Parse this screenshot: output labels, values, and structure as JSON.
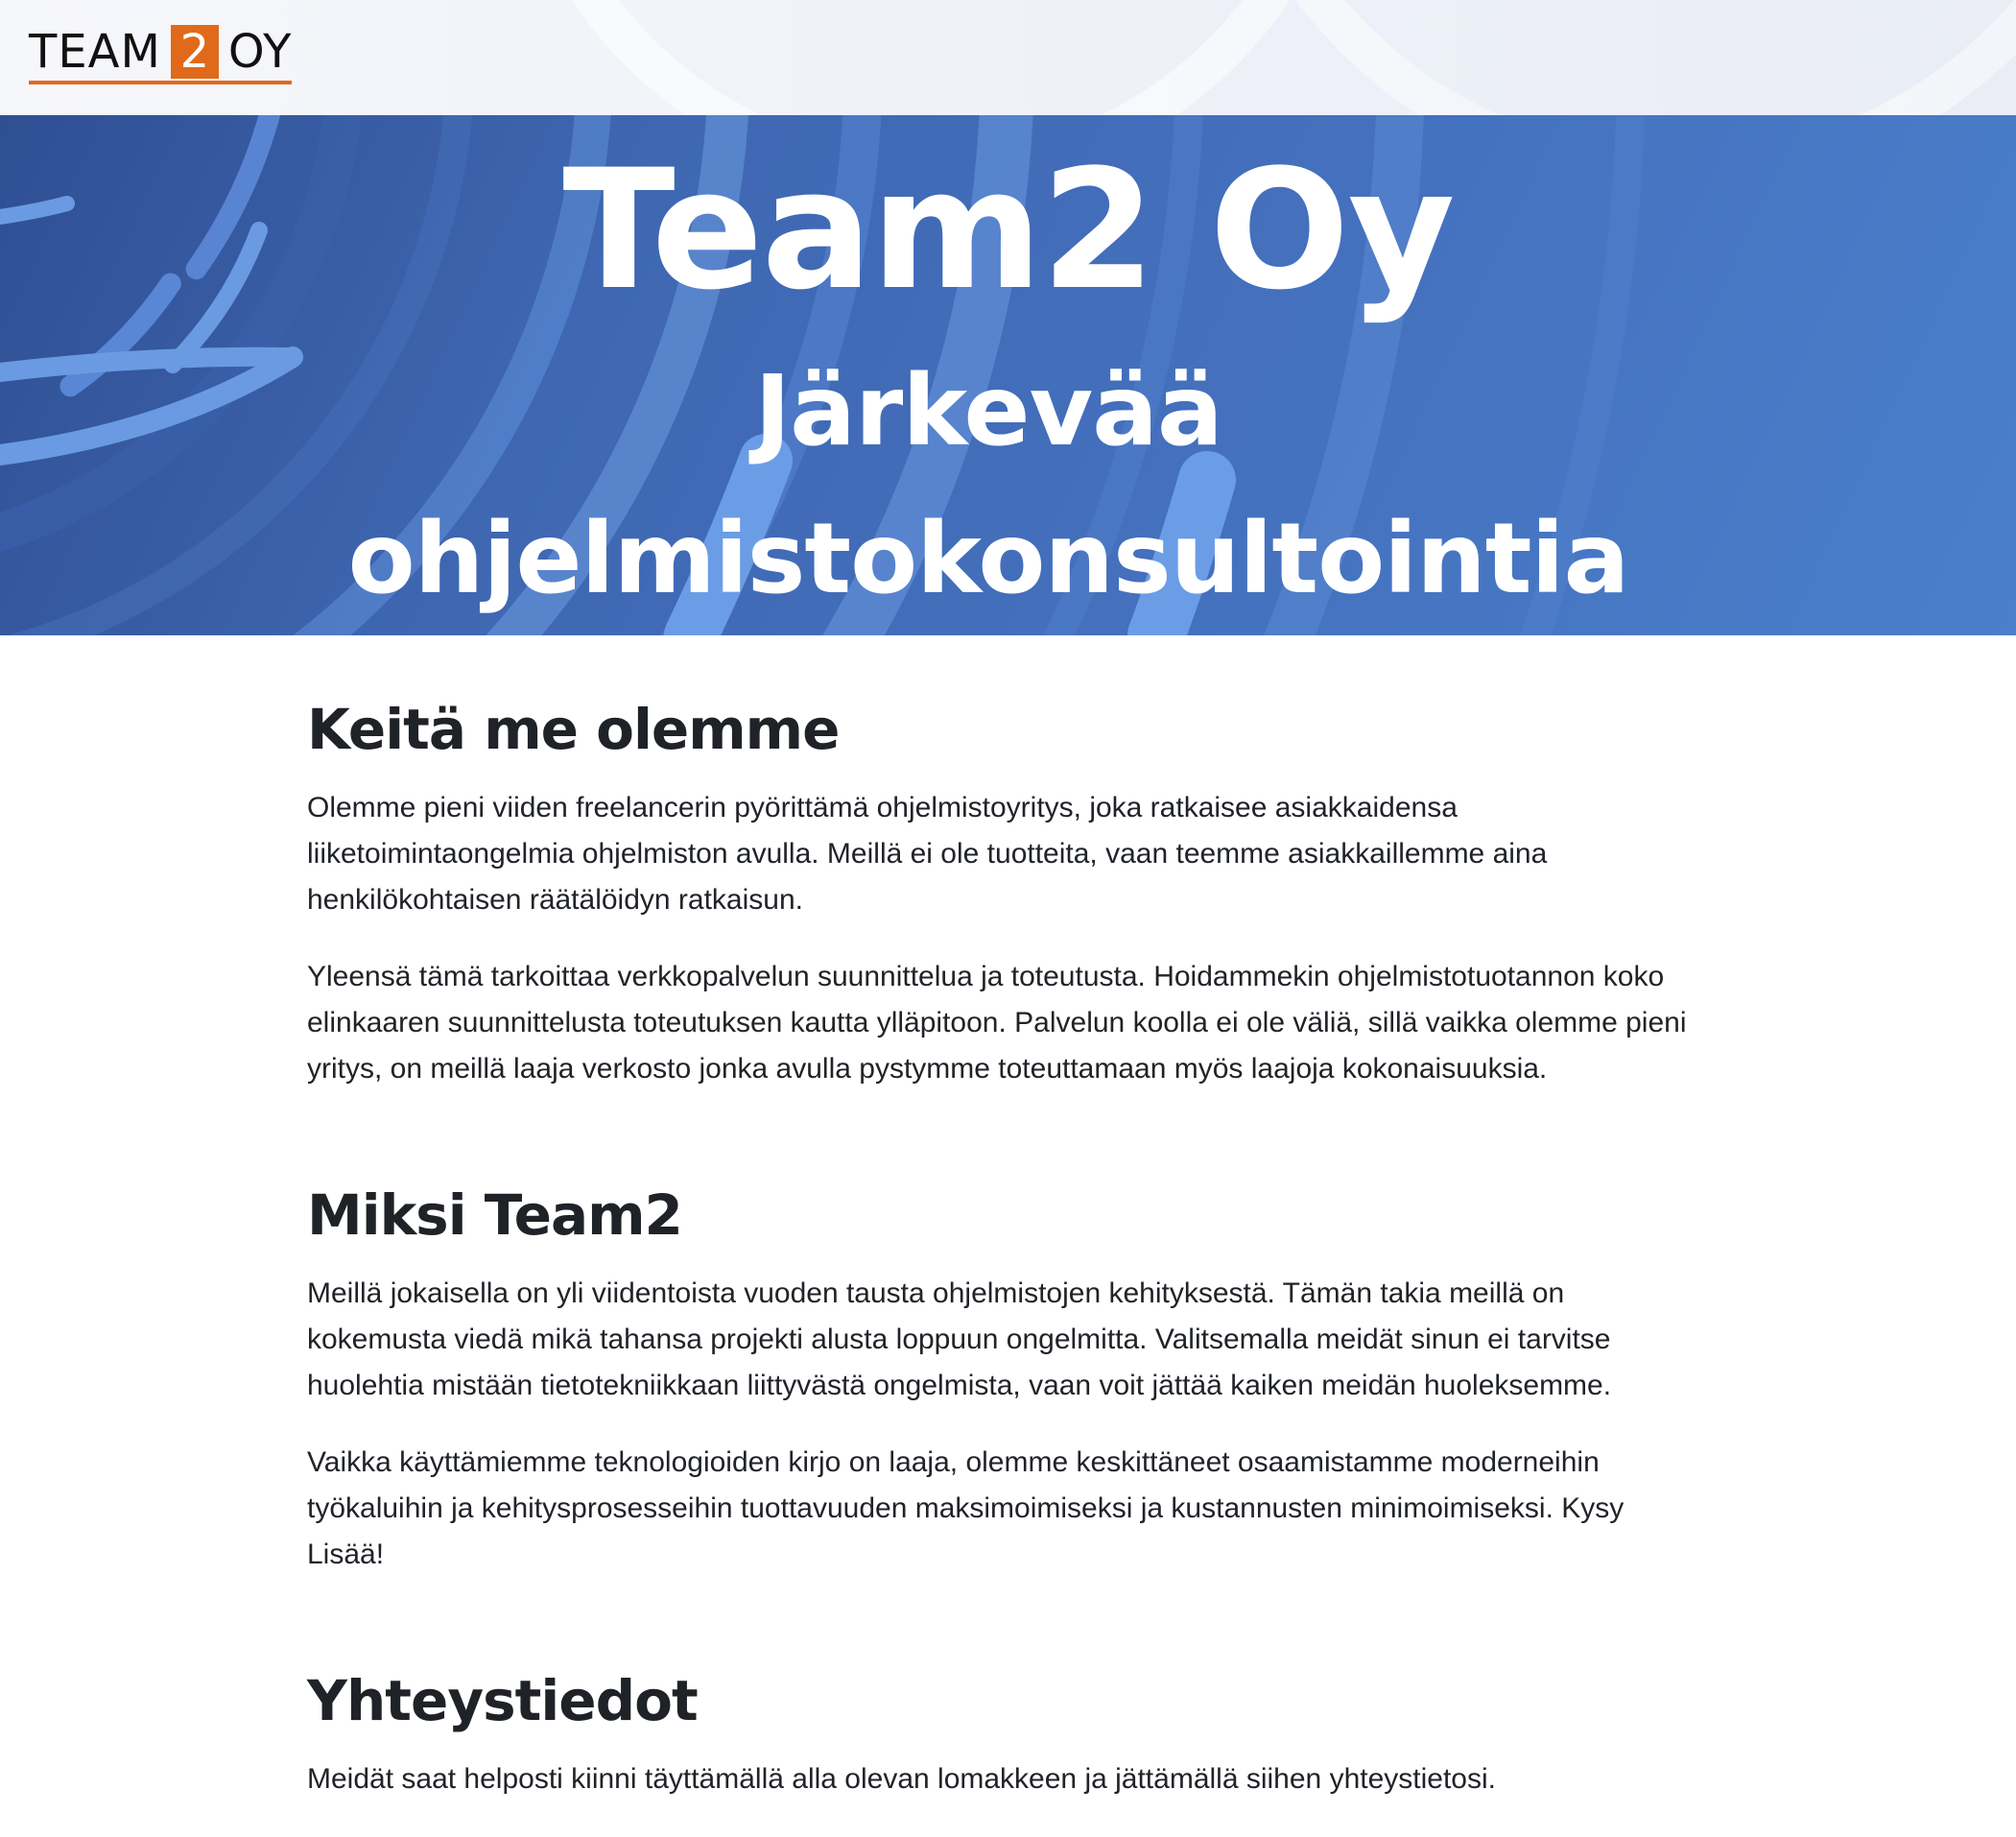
{
  "header": {
    "logo": {
      "text_left": "TEAM",
      "text_box": "2",
      "text_right": "OY",
      "accent_color": "#e06a1a"
    }
  },
  "hero": {
    "title": "Team2 Oy",
    "subtitle": "Järkevää ohjelmistokonsultointia",
    "background_color": "#4470bd"
  },
  "sections": [
    {
      "heading": "Keitä me olemme",
      "paragraphs": [
        "Olemme pieni viiden freelancerin pyörittämä ohjelmistoyritys, joka ratkaisee asiakkaidensa liiketoimintaongelmia ohjelmiston avulla. Meillä ei ole tuotteita, vaan teemme asiakkaillemme aina henkilökohtaisen räätälöidyn ratkaisun.",
        "Yleensä tämä tarkoittaa verkkopalvelun suunnittelua ja toteutusta. Hoidammekin ohjelmistotuotannon koko elinkaaren suunnittelusta toteutuksen kautta ylläpitoon. Palvelun koolla ei ole väliä, sillä vaikka olemme pieni yritys, on meillä laaja verkosto jonka avulla pystymme toteuttamaan myös laajoja kokonaisuuksia."
      ]
    },
    {
      "heading": "Miksi Team2",
      "paragraphs": [
        "Meillä jokaisella on yli viidentoista vuoden tausta ohjelmistojen kehityksestä. Tämän takia meillä on kokemusta viedä mikä tahansa projekti alusta loppuun ongelmitta. Valitsemalla meidät sinun ei tarvitse huolehtia mistään tietotekniikkaan liittyvästä ongelmista, vaan voit jättää kaiken meidän huoleksemme.",
        "Vaikka käyttämiemme teknologioiden kirjo on laaja, olemme keskittäneet osaamistamme moderneihin työkaluihin ja kehitysprosesseihin tuottavuuden maksimoimiseksi ja kustannusten minimoimiseksi. Kysy Lisää!"
      ]
    },
    {
      "heading": "Yhteystiedot",
      "paragraphs": [
        "Meidät saat helposti kiinni täyttämällä alla olevan lomakkeen ja jättämällä siihen yhteystietosi."
      ]
    }
  ]
}
